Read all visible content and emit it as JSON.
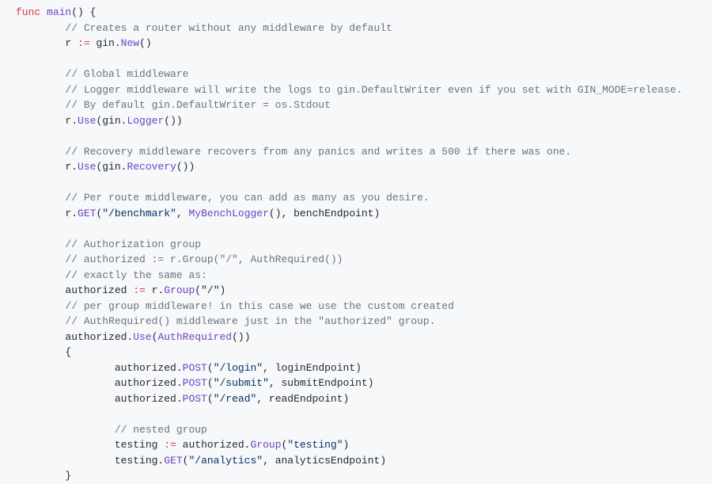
{
  "code": {
    "line1_kw": "func",
    "line1_fn": "main",
    "line1_rest": "() {",
    "line2_comment": "// Creates a router without any middleware by default",
    "line3_a": "r ",
    "line3_op": ":=",
    "line3_b": " gin.",
    "line3_fn": "New",
    "line3_c": "()",
    "line5_comment": "// Global middleware",
    "line6_comment": "// Logger middleware will write the logs to gin.DefaultWriter even if you set with GIN_MODE=release.",
    "line7_comment": "// By default gin.DefaultWriter = os.Stdout",
    "line8_a": "r.",
    "line8_fn1": "Use",
    "line8_b": "(gin.",
    "line8_fn2": "Logger",
    "line8_c": "())",
    "line10_comment": "// Recovery middleware recovers from any panics and writes a 500 if there was one.",
    "line11_a": "r.",
    "line11_fn1": "Use",
    "line11_b": "(gin.",
    "line11_fn2": "Recovery",
    "line11_c": "())",
    "line13_comment": "// Per route middleware, you can add as many as you desire.",
    "line14_a": "r.",
    "line14_fn1": "GET",
    "line14_b": "(",
    "line14_str": "\"/benchmark\"",
    "line14_c": ", ",
    "line14_fn2": "MyBenchLogger",
    "line14_d": "(), benchEndpoint)",
    "line16_comment": "// Authorization group",
    "line17_comment": "// authorized := r.Group(\"/\", AuthRequired())",
    "line18_comment": "// exactly the same as:",
    "line19_a": "authorized ",
    "line19_op": ":=",
    "line19_b": " r.",
    "line19_fn": "Group",
    "line19_c": "(",
    "line19_str": "\"/\"",
    "line19_d": ")",
    "line20_comment": "// per group middleware! in this case we use the custom created",
    "line21_comment": "// AuthRequired() middleware just in the \"authorized\" group.",
    "line22_a": "authorized.",
    "line22_fn1": "Use",
    "line22_b": "(",
    "line22_fn2": "AuthRequired",
    "line22_c": "())",
    "line23": "{",
    "line24_a": "authorized.",
    "line24_fn": "POST",
    "line24_b": "(",
    "line24_str": "\"/login\"",
    "line24_c": ", loginEndpoint)",
    "line25_a": "authorized.",
    "line25_fn": "POST",
    "line25_b": "(",
    "line25_str": "\"/submit\"",
    "line25_c": ", submitEndpoint)",
    "line26_a": "authorized.",
    "line26_fn": "POST",
    "line26_b": "(",
    "line26_str": "\"/read\"",
    "line26_c": ", readEndpoint)",
    "line28_comment": "// nested group",
    "line29_a": "testing ",
    "line29_op": ":=",
    "line29_b": " authorized.",
    "line29_fn": "Group",
    "line29_c": "(",
    "line29_str": "\"testing\"",
    "line29_d": ")",
    "line30_a": "testing.",
    "line30_fn": "GET",
    "line30_b": "(",
    "line30_str": "\"/analytics\"",
    "line30_c": ", analyticsEndpoint)",
    "line31": "}"
  }
}
